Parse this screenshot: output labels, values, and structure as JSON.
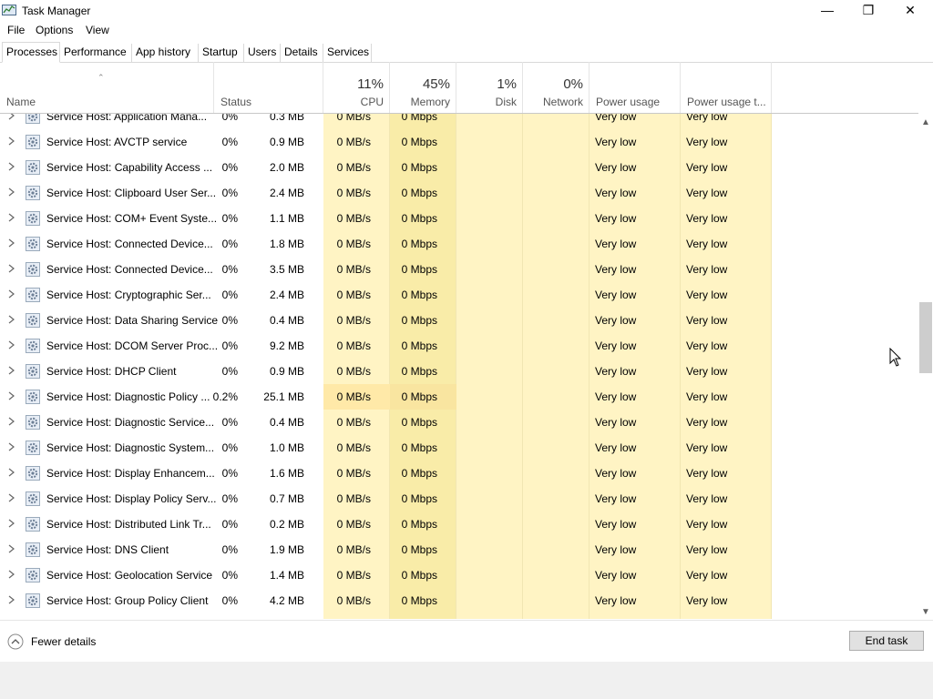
{
  "window": {
    "title": "Task Manager",
    "minimize_glyph": "—",
    "restore_glyph": "❐",
    "close_glyph": "✕"
  },
  "menu": [
    "File",
    "Options",
    "View"
  ],
  "tabs": [
    {
      "label": "Processes",
      "active": true
    },
    {
      "label": "Performance",
      "active": false
    },
    {
      "label": "App history",
      "active": false
    },
    {
      "label": "Startup",
      "active": false
    },
    {
      "label": "Users",
      "active": false
    },
    {
      "label": "Details",
      "active": false
    },
    {
      "label": "Services",
      "active": false
    }
  ],
  "columns": {
    "name": "Name",
    "status": "Status",
    "cpu": {
      "pct": "11%",
      "label": "CPU"
    },
    "memory": {
      "pct": "45%",
      "label": "Memory"
    },
    "disk": {
      "pct": "1%",
      "label": "Disk"
    },
    "network": {
      "pct": "0%",
      "label": "Network"
    },
    "power": "Power usage",
    "power_trend": "Power usage t..."
  },
  "rows": [
    {
      "name": "Service Host: Application Mana...",
      "cpu": "0%",
      "memory": "0.3 MB",
      "disk": "0 MB/s",
      "network": "0 Mbps",
      "power": "Very low",
      "power_trend": "Very low"
    },
    {
      "name": "Service Host: AVCTP service",
      "cpu": "0%",
      "memory": "0.9 MB",
      "disk": "0 MB/s",
      "network": "0 Mbps",
      "power": "Very low",
      "power_trend": "Very low"
    },
    {
      "name": "Service Host: Capability Access ...",
      "cpu": "0%",
      "memory": "2.0 MB",
      "disk": "0 MB/s",
      "network": "0 Mbps",
      "power": "Very low",
      "power_trend": "Very low"
    },
    {
      "name": "Service Host: Clipboard User Ser...",
      "cpu": "0%",
      "memory": "2.4 MB",
      "disk": "0 MB/s",
      "network": "0 Mbps",
      "power": "Very low",
      "power_trend": "Very low"
    },
    {
      "name": "Service Host: COM+ Event Syste...",
      "cpu": "0%",
      "memory": "1.1 MB",
      "disk": "0 MB/s",
      "network": "0 Mbps",
      "power": "Very low",
      "power_trend": "Very low"
    },
    {
      "name": "Service Host: Connected Device...",
      "cpu": "0%",
      "memory": "1.8 MB",
      "disk": "0 MB/s",
      "network": "0 Mbps",
      "power": "Very low",
      "power_trend": "Very low"
    },
    {
      "name": "Service Host: Connected Device...",
      "cpu": "0%",
      "memory": "3.5 MB",
      "disk": "0 MB/s",
      "network": "0 Mbps",
      "power": "Very low",
      "power_trend": "Very low"
    },
    {
      "name": "Service Host: Cryptographic Ser...",
      "cpu": "0%",
      "memory": "2.4 MB",
      "disk": "0 MB/s",
      "network": "0 Mbps",
      "power": "Very low",
      "power_trend": "Very low"
    },
    {
      "name": "Service Host: Data Sharing Service",
      "cpu": "0%",
      "memory": "0.4 MB",
      "disk": "0 MB/s",
      "network": "0 Mbps",
      "power": "Very low",
      "power_trend": "Very low"
    },
    {
      "name": "Service Host: DCOM Server Proc...",
      "cpu": "0%",
      "memory": "9.2 MB",
      "disk": "0 MB/s",
      "network": "0 Mbps",
      "power": "Very low",
      "power_trend": "Very low"
    },
    {
      "name": "Service Host: DHCP Client",
      "cpu": "0%",
      "memory": "0.9 MB",
      "disk": "0 MB/s",
      "network": "0 Mbps",
      "power": "Very low",
      "power_trend": "Very low"
    },
    {
      "name": "Service Host: Diagnostic Policy ...",
      "cpu": "0.2%",
      "memory": "25.1 MB",
      "disk": "0 MB/s",
      "network": "0 Mbps",
      "power": "Very low",
      "power_trend": "Very low"
    },
    {
      "name": "Service Host: Diagnostic Service...",
      "cpu": "0%",
      "memory": "0.4 MB",
      "disk": "0 MB/s",
      "network": "0 Mbps",
      "power": "Very low",
      "power_trend": "Very low"
    },
    {
      "name": "Service Host: Diagnostic System...",
      "cpu": "0%",
      "memory": "1.0 MB",
      "disk": "0 MB/s",
      "network": "0 Mbps",
      "power": "Very low",
      "power_trend": "Very low"
    },
    {
      "name": "Service Host: Display Enhancem...",
      "cpu": "0%",
      "memory": "1.6 MB",
      "disk": "0 MB/s",
      "network": "0 Mbps",
      "power": "Very low",
      "power_trend": "Very low"
    },
    {
      "name": "Service Host: Display Policy Serv...",
      "cpu": "0%",
      "memory": "0.7 MB",
      "disk": "0 MB/s",
      "network": "0 Mbps",
      "power": "Very low",
      "power_trend": "Very low"
    },
    {
      "name": "Service Host: Distributed Link Tr...",
      "cpu": "0%",
      "memory": "0.2 MB",
      "disk": "0 MB/s",
      "network": "0 Mbps",
      "power": "Very low",
      "power_trend": "Very low"
    },
    {
      "name": "Service Host: DNS Client",
      "cpu": "0%",
      "memory": "1.9 MB",
      "disk": "0 MB/s",
      "network": "0 Mbps",
      "power": "Very low",
      "power_trend": "Very low"
    },
    {
      "name": "Service Host: Geolocation Service",
      "cpu": "0%",
      "memory": "1.4 MB",
      "disk": "0 MB/s",
      "network": "0 Mbps",
      "power": "Very low",
      "power_trend": "Very low"
    },
    {
      "name": "Service Host: Group Policy Client",
      "cpu": "0%",
      "memory": "4.2 MB",
      "disk": "0 MB/s",
      "network": "0 Mbps",
      "power": "Very low",
      "power_trend": "Very low"
    }
  ],
  "footer": {
    "fewer_details": "Fewer details",
    "end_task": "End task"
  },
  "icons": {
    "row_icon": "service-gear-icon",
    "expand": "chevron-right-icon",
    "sort": "sort-up-icon",
    "sort_glyph": "⌃",
    "scroll_up_glyph": "▲",
    "scroll_down_glyph": "▼"
  },
  "colors": {
    "heat_light": "#fff4c4",
    "heat_mid": "#f9eca8",
    "cpu_hot": "#ffe9a8",
    "mem_hot": "#f9e5a0"
  }
}
